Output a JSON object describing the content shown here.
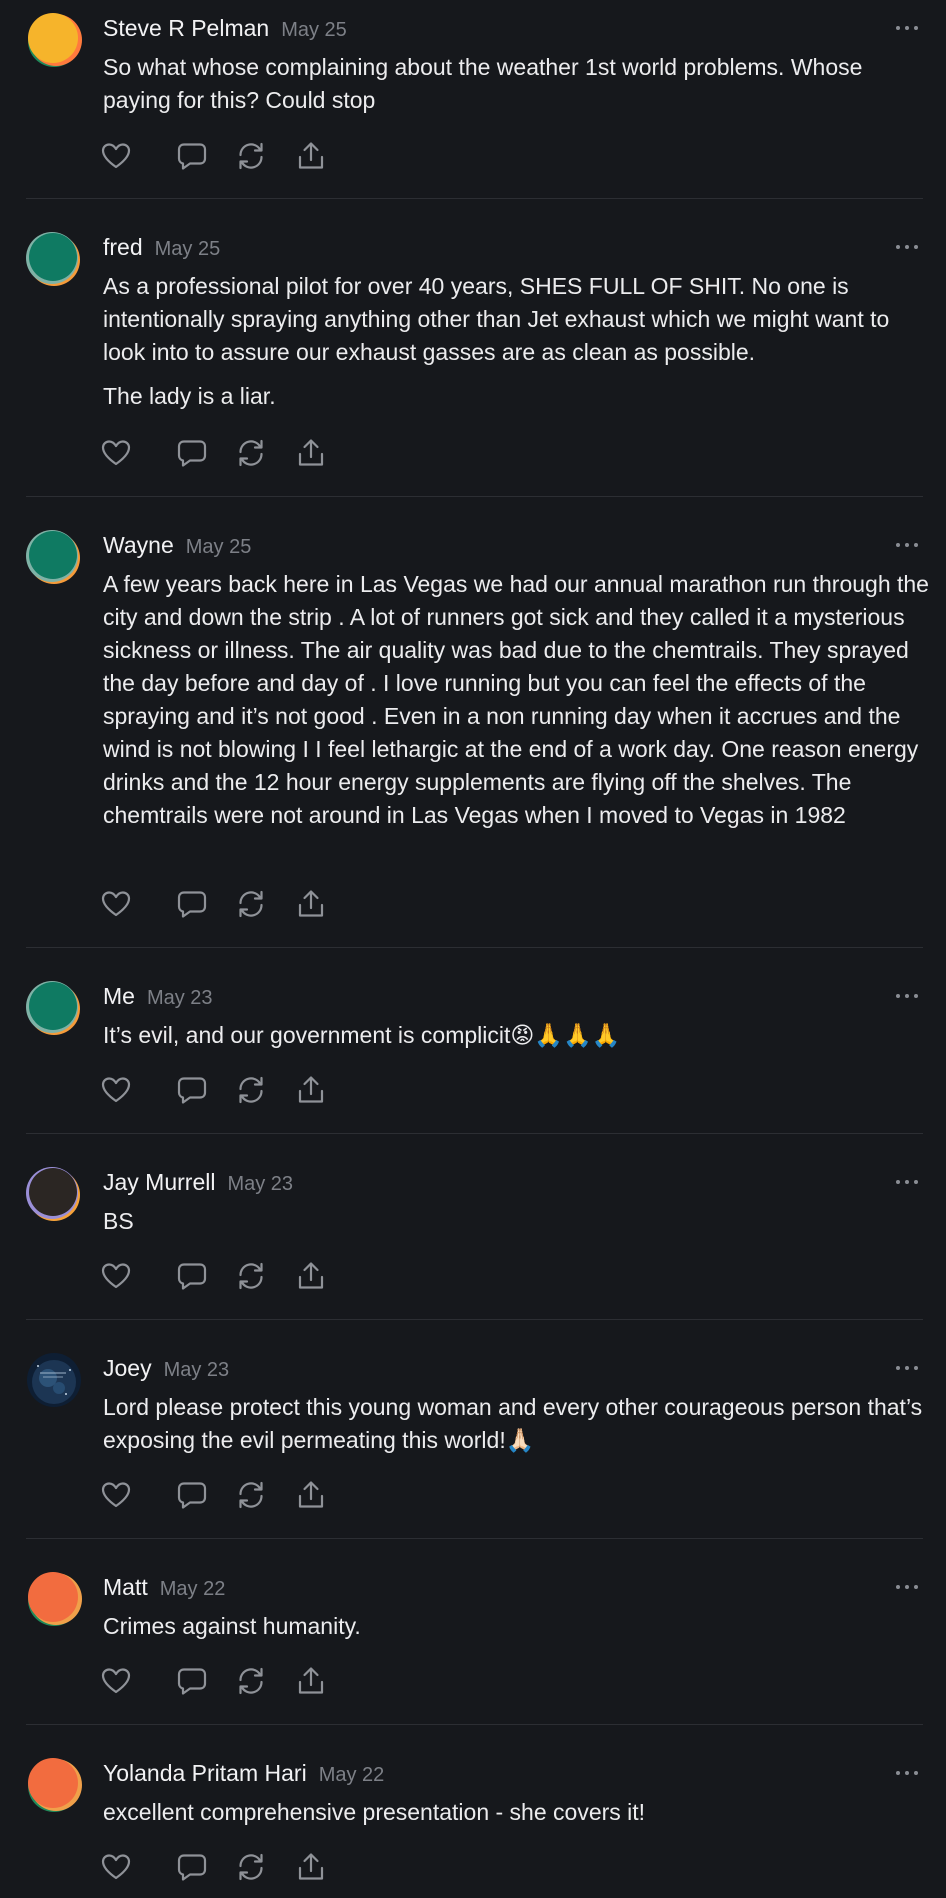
{
  "comments": [
    {
      "author": "Steve R Pelman",
      "date": "May 25",
      "avatar": {
        "icon": "avatar-icon",
        "main": "#f6b42b",
        "ring": [
          "#ff7a3d",
          "#1f8a5b"
        ]
      },
      "paragraphs": [
        "So what whose complaining about the weather 1st world problems. Whose paying for this? Could stop"
      ]
    },
    {
      "author": "fred",
      "date": "May 25",
      "avatar": {
        "icon": "avatar-icon",
        "main": "#0f7a62",
        "ring": [
          "#f59b3a",
          "#7fb2a6"
        ]
      },
      "paragraphs": [
        "As a professional pilot for over 40 years, SHES FULL OF SHIT. No one is intentionally spraying anything other than Jet exhaust which we might want to look into to assure our exhaust gasses are as clean as possible.",
        "The lady is a liar."
      ]
    },
    {
      "author": "Wayne",
      "date": "May 25",
      "avatar": {
        "icon": "avatar-icon",
        "main": "#0f7a62",
        "ring": [
          "#f59b3a",
          "#7fb2a6"
        ]
      },
      "paragraphs": [
        "A few years back here in Las Vegas we had our annual marathon run through the city and down the strip . A lot of runners got sick and they called it a mysterious sickness or illness. The air quality was bad due to the chemtrails. They sprayed the day before and day of . I love running but you can feel the effects of the spraying and it’s not good . Even in a non running day when it accrues and the wind is not blowing I I feel lethargic at the end of a work day. One reason energy drinks and the 12 hour energy supplements are flying off the shelves. The chemtrails were not around in Las Vegas when I moved to Vegas in 1982"
      ]
    },
    {
      "author": "Me",
      "date": "May 23",
      "avatar": {
        "icon": "avatar-icon",
        "main": "#0f7a62",
        "ring": [
          "#f59b3a",
          "#7fb2a6"
        ]
      },
      "paragraphs": [
        "It’s evil, and our government is complicit😡🙏🙏🙏"
      ]
    },
    {
      "author": "Jay Murrell",
      "date": "May 23",
      "avatar": {
        "icon": "avatar-icon",
        "main": "#2b2623",
        "ring": [
          "#f5a23a",
          "#9a8fd8"
        ]
      },
      "paragraphs": [
        "BS"
      ]
    },
    {
      "author": "Joey",
      "date": "May 23",
      "avatar": {
        "icon": "avatar-photo-icon",
        "main": "#1c3553",
        "ring": [
          "#0e1e33",
          "#0e1e33"
        ]
      },
      "paragraphs": [
        "Lord please protect this young woman and every other courageous person that’s exposing the evil permeating this world!🙏🏻"
      ]
    },
    {
      "author": "Matt",
      "date": "May 22",
      "avatar": {
        "icon": "avatar-icon",
        "main": "#f26c3f",
        "ring": [
          "#1f8a5b",
          "#f0a04a"
        ]
      },
      "paragraphs": [
        "Crimes against humanity."
      ]
    },
    {
      "author": "Yolanda Pritam Hari",
      "date": "May 22",
      "avatar": {
        "icon": "avatar-icon",
        "main": "#f26c3f",
        "ring": [
          "#1f8a5b",
          "#f0a04a"
        ]
      },
      "paragraphs": [
        "excellent comprehensive presentation - she covers it!"
      ]
    }
  ],
  "actions": [
    "like-heart-icon",
    "reply-comment-icon",
    "restack-icon",
    "share-icon"
  ],
  "more_icon": "more-options-icon",
  "colors": {
    "background": "#16181c",
    "text": "#ececee",
    "muted": "#7d8087",
    "icon": "#8f9298",
    "divider": "#2c2e33"
  }
}
